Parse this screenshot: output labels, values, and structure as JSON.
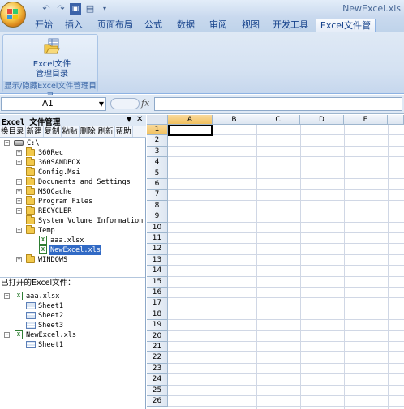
{
  "window": {
    "title": "NewExcel.xls"
  },
  "ribbon": {
    "tabs": [
      {
        "label": "开始"
      },
      {
        "label": "插入"
      },
      {
        "label": "页面布局"
      },
      {
        "label": "公式"
      },
      {
        "label": "数据"
      },
      {
        "label": "审阅"
      },
      {
        "label": "视图"
      },
      {
        "label": "开发工具"
      },
      {
        "label": "Excel文件管理",
        "active": true
      }
    ],
    "group": {
      "button_line1": "Excel文件",
      "button_line2": "管理目录",
      "label": "显示/隐藏Excel文件管理目录"
    }
  },
  "formula_bar": {
    "name_box": "A1",
    "fx": "fx",
    "formula": ""
  },
  "pane": {
    "title": "Excel 文件管理",
    "toolbar": [
      "换目录",
      "新建",
      "复制",
      "粘贴",
      "删除",
      "刷新",
      "帮助"
    ],
    "tree": {
      "drive": "C:\\",
      "folders": [
        "360Rec",
        "360SANDBOX",
        "Config.Msi",
        "Documents and Settings",
        "MSOCache",
        "Program Files",
        "RECYCLER",
        "System Volume Information",
        "Temp",
        "WINDOWS"
      ],
      "temp_files": [
        "aaa.xlsx",
        "NewExcel.xls"
      ],
      "selected_file": "NewExcel.xls"
    },
    "opened": {
      "title": "已打开的Excel文件：",
      "workbooks": [
        {
          "name": "aaa.xlsx",
          "sheets": [
            "Sheet1",
            "Sheet2",
            "Sheet3"
          ]
        },
        {
          "name": "NewExcel.xls",
          "sheets": [
            "Sheet1"
          ]
        }
      ]
    }
  },
  "grid": {
    "columns": [
      "A",
      "B",
      "C",
      "D",
      "E"
    ],
    "rows": [
      "1",
      "2",
      "3",
      "4",
      "5",
      "6",
      "7",
      "8",
      "9",
      "10",
      "11",
      "12",
      "13",
      "14",
      "15",
      "16",
      "17",
      "18",
      "19",
      "20",
      "21",
      "22",
      "23",
      "24",
      "25",
      "26"
    ],
    "active_cell": "A1"
  },
  "colors": {
    "ribbon_text": "#15428b",
    "selection_header": "#f1c15f",
    "tree_selection": "#316ac5"
  }
}
